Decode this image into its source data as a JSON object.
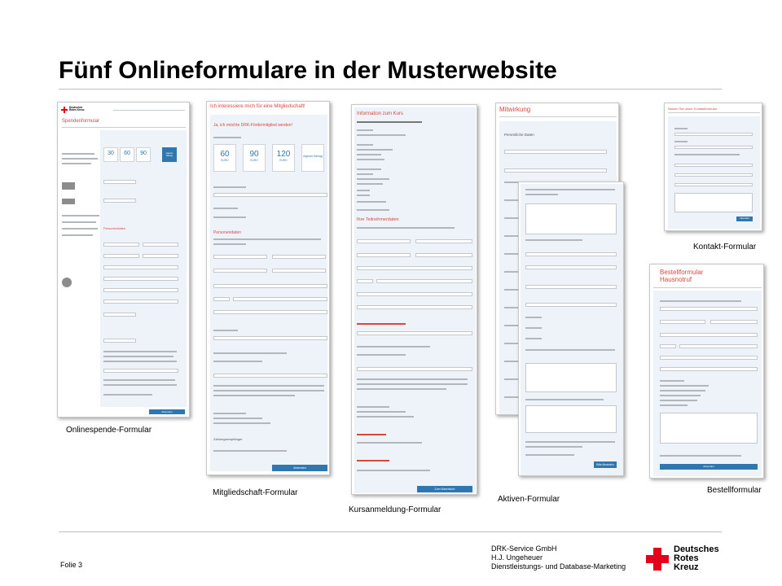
{
  "slide": {
    "title": "Fünf Onlineformulare in der Musterwebsite"
  },
  "forms": {
    "spende": {
      "caption": "Onlinespende-Formular",
      "heading": "Spendenformular",
      "logo": "Deutsches Rotes Kreuz",
      "amounts": [
        "30",
        "60",
        "90"
      ],
      "amount_other": "eigener Betrag",
      "section_person": "Personendaten",
      "submit": "Absenden"
    },
    "mitglied": {
      "caption": "Mitgliedschaft-Formular",
      "heading": "Ich interessiere mich für eine Mitgliedschaft!",
      "subheading": "Ja, ich möchte DRK-Fördermitglied werden!",
      "amounts": [
        "60",
        "90",
        "120"
      ],
      "amount_unit": "EURO",
      "amount_other": "eigener Betrag",
      "section_person": "Personendaten",
      "section_payment": "Zahlungsempfänger",
      "submit": "Absenden"
    },
    "kurs": {
      "caption": "Kursanmeldung-Formular",
      "heading": "Information zum Kurs",
      "section_participant": "Ihre Teilnehmerdaten",
      "submit": "Zum Warenkorb"
    },
    "aktiv": {
      "caption": "Aktiven-Formular",
      "heading": "Mitwirkung",
      "section_person": "Persönliche Daten",
      "submit": "Bitte Absenden"
    },
    "kontakt": {
      "caption": "Kontakt-Formular",
      "heading": "Nutzen Sie unser Kontaktformular",
      "submit": "Absenden"
    },
    "bestell": {
      "caption": "Bestellformular",
      "heading": "Bestellformular Hausnotruf",
      "submit": "Absenden"
    }
  },
  "footer": {
    "slide_number": "Folie 3",
    "sender_lines": [
      "DRK-Service GmbH",
      "H.J. Ungeheuer",
      "Dienstleistungs- und Database-Marketing"
    ],
    "logo_text": [
      "Deutsches",
      "Rotes",
      "Kreuz"
    ]
  }
}
